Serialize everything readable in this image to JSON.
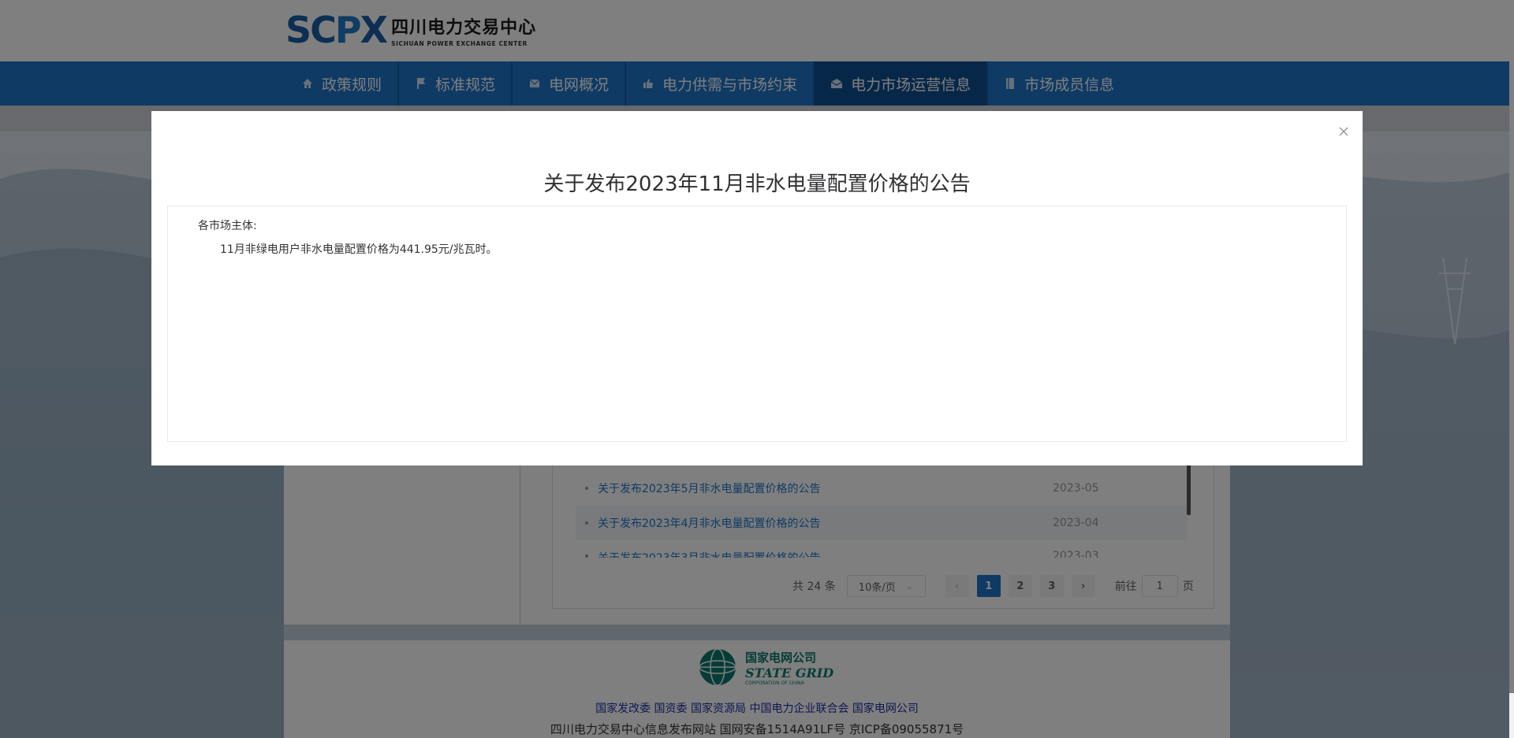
{
  "header": {
    "logo_mark_a": "SC",
    "logo_mark_b": "P",
    "logo_mark_c": "X",
    "logo_cn": "四川电力交易中心",
    "logo_en": "SICHUAN POWER EXCHANGE CENTER"
  },
  "nav": {
    "items": [
      {
        "label": "政策规则",
        "icon": "home-icon"
      },
      {
        "label": "标准规范",
        "icon": "flag-icon"
      },
      {
        "label": "电网概况",
        "icon": "mail-icon"
      },
      {
        "label": "电力供需与市场约束",
        "icon": "thumb-icon"
      },
      {
        "label": "电力市场运营信息",
        "icon": "envelope-open-icon"
      },
      {
        "label": "市场成员信息",
        "icon": "book-icon"
      }
    ],
    "active_index": 4
  },
  "list": {
    "rows": [
      {
        "title": "关于发布2023年5月非水电量配置价格的公告",
        "date": "2023-05"
      },
      {
        "title": "关于发布2023年4月非水电量配置价格的公告",
        "date": "2023-04"
      },
      {
        "title": "关于发布2023年3月非水电量配置价格的公告",
        "date": "2023-03"
      }
    ]
  },
  "pager": {
    "total": "共 24 条",
    "page_size": "10条/页",
    "pages": [
      "1",
      "2",
      "3"
    ],
    "current": "1",
    "goto_label": "前往",
    "goto_value": "1",
    "page_unit": "页"
  },
  "footer": {
    "logo_cn": "国家电网公司",
    "logo_en": "STATE GRID",
    "logo_sub": "CORPORATION OF CHINA",
    "links": "国家发改委 国资委 国家资源局 中国电力企业联合会 国家电网公司",
    "icp": "四川电力交易中心信息发布网站 国网安备1514A91LF号 京ICP备09055871号"
  },
  "modal": {
    "title": "关于发布2023年11月非水电量配置价格的公告",
    "salutation": "各市场主体:",
    "body": "11月非绿电用户非水电量配置价格为441.95元/兆瓦时。"
  },
  "colors": {
    "nav_blue": "#1e74c8",
    "nav_active": "#0e4f92",
    "link_blue": "#1e74c8"
  }
}
